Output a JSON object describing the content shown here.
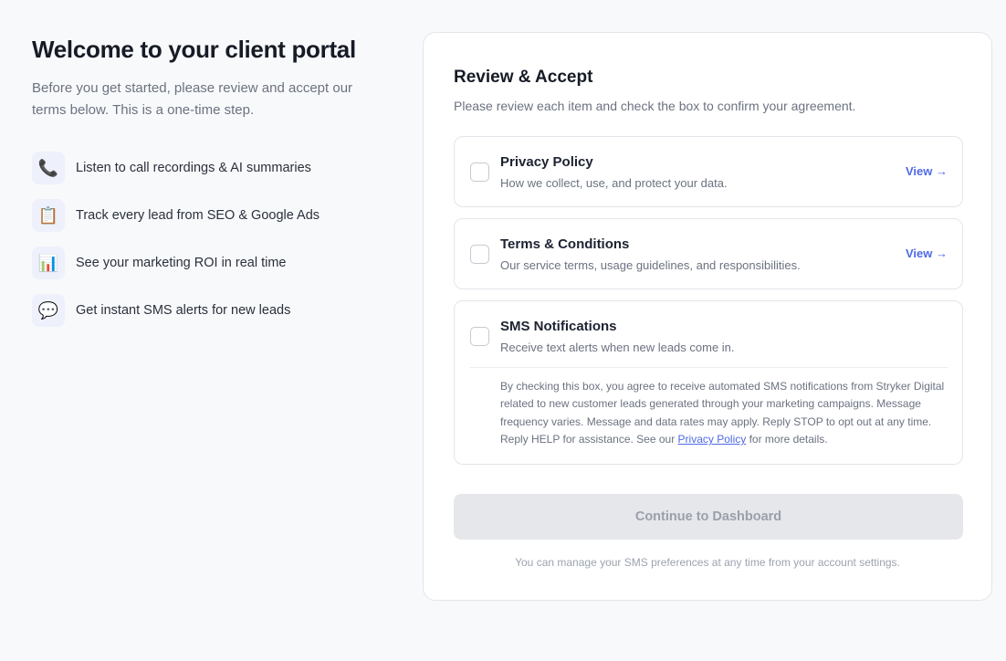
{
  "intro": {
    "title": "Welcome to your client portal",
    "subtitle": "Before you get started, please review and accept our terms below. This is a one-time step."
  },
  "features": [
    {
      "icon": "phone-icon",
      "glyph": "📞",
      "label": "Listen to call recordings & AI summaries"
    },
    {
      "icon": "clipboard-icon",
      "glyph": "📋",
      "label": "Track every lead from SEO & Google Ads"
    },
    {
      "icon": "bar-chart-icon",
      "glyph": "📊",
      "label": "See your marketing ROI in real time"
    },
    {
      "icon": "speech-bubble-icon",
      "glyph": "💬",
      "label": "Get instant SMS alerts for new leads"
    }
  ],
  "review": {
    "title": "Review & Accept",
    "subtitle": "Please review each item and check the box to confirm your agreement.",
    "items": [
      {
        "title": "Privacy Policy",
        "description": "How we collect, use, and protect your data.",
        "link": "View →",
        "checked": false
      },
      {
        "title": "Terms & Conditions",
        "description": "Our service terms, usage guidelines, and responsibilities.",
        "link": "View →",
        "checked": false
      },
      {
        "title": "SMS Notifications",
        "description": "Receive text alerts when new leads come in.",
        "checked": false
      }
    ],
    "sms_legal_before": "By checking this box, you agree to receive automated SMS notifications from Stryker Digital related to new customer leads generated through your marketing campaigns. Message frequency varies. Message and data rates may apply. Reply STOP to opt out at any time. Reply HELP for assistance. See our ",
    "sms_legal_link": "Privacy Policy",
    "sms_legal_after": " for more details.",
    "continue_label": "Continue to Dashboard",
    "footnote": "You can manage your SMS preferences at any time from your account settings."
  },
  "colors": {
    "accent": "#4f6ae6",
    "page_bg": "#f8f9fb",
    "button_disabled_bg": "#e6e7eb",
    "icon_bg": "#eef0fb"
  }
}
